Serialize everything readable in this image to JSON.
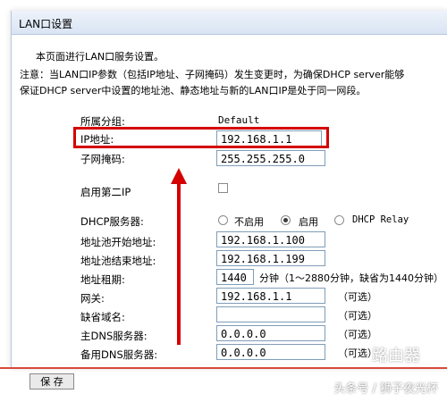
{
  "window": {
    "title": "LAN口设置"
  },
  "intro": "本页面进行LAN口服务设置。",
  "note": {
    "line1": "注意：当LAN口IP参数（包括IP地址、子网掩码）发生变更时，为确保DHCP server能够",
    "line2": "保证DHCP server中设置的地址池、静态地址与新的LAN口IP是处于同一网段。"
  },
  "form": {
    "group": {
      "label": "所属分组:",
      "value": "Default"
    },
    "ip": {
      "label": "IP地址:",
      "value": "192.168.1.1"
    },
    "mask": {
      "label": "子网掩码:",
      "value": "255.255.255.0"
    },
    "second_ip": {
      "label": "启用第二IP",
      "checked": false
    },
    "dhcp": {
      "label": "DHCP服务器:",
      "options": [
        "不启用",
        "启用",
        "DHCP Relay"
      ],
      "selected": "启用"
    },
    "pool_start": {
      "label": "地址池开始地址:",
      "value": "192.168.1.100"
    },
    "pool_end": {
      "label": "地址池结束地址:",
      "value": "192.168.1.199"
    },
    "lease": {
      "label": "地址租期:",
      "value": "1440",
      "hint": "分钟（1～2880分钟，缺省为1440分钟）"
    },
    "gateway": {
      "label": "网关:",
      "value": "192.168.1.1",
      "hint": "（可选）"
    },
    "domain": {
      "label": "缺省域名:",
      "value": "",
      "hint": "（可选）"
    },
    "dns1": {
      "label": "主DNS服务器:",
      "value": "0.0.0.0",
      "hint": "（可选）"
    },
    "dns2": {
      "label": "备用DNS服务器:",
      "value": "0.0.0.0",
      "hint": "（可选）"
    }
  },
  "buttons": {
    "save": "保 存"
  },
  "watermark": {
    "logo": "路由器",
    "caption": "头条号 / 狮子夜光杯"
  },
  "colors": {
    "highlight": "#d40000",
    "input_border": "#7f9db9"
  }
}
